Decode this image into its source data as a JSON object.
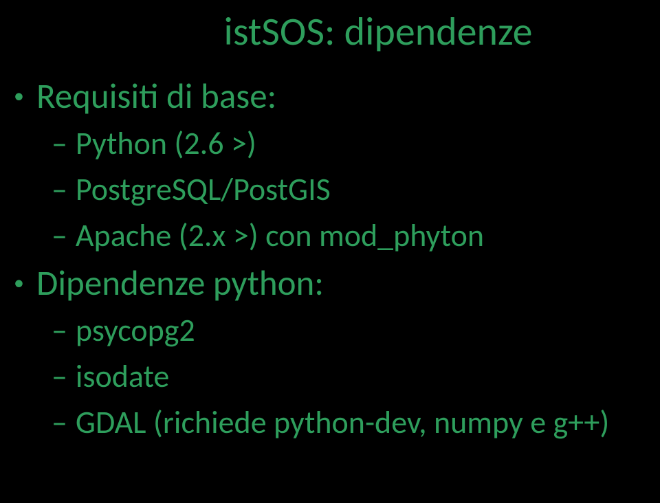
{
  "title": "istSOS: dipendenze",
  "items": [
    {
      "level": 1,
      "text": "Requisiti di base:"
    },
    {
      "level": 2,
      "text": "Python (2.6 >)"
    },
    {
      "level": 2,
      "text": "PostgreSQL/PostGIS"
    },
    {
      "level": 2,
      "text": "Apache (2.x >) con mod_phyton"
    },
    {
      "level": 1,
      "text": "Dipendenze python:"
    },
    {
      "level": 2,
      "text": "psycopg2"
    },
    {
      "level": 2,
      "text": "isodate"
    },
    {
      "level": 2,
      "text": "GDAL (richiede python-dev, numpy e g++)"
    }
  ]
}
